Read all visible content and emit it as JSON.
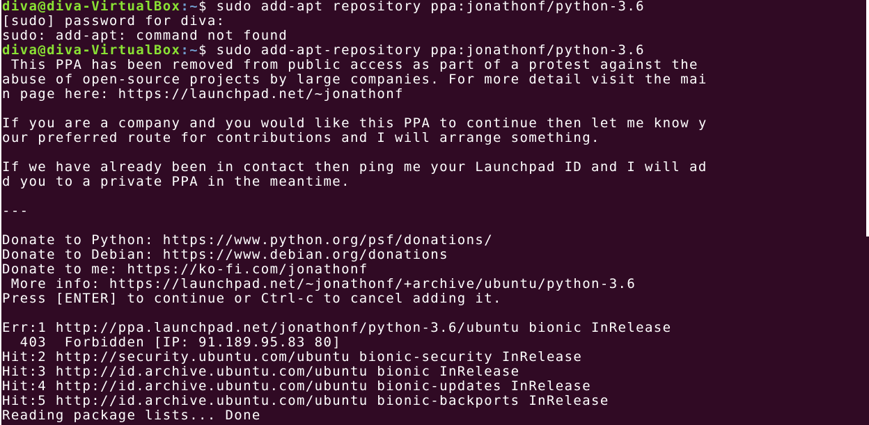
{
  "terminal": {
    "prompt_user": "diva@diva-VirtualBox",
    "prompt_path": ":~",
    "prompt_symbol": "$ ",
    "colors": {
      "background": "#300a24",
      "text": "#ffffff",
      "prompt_user": "#8ae234",
      "prompt_path": "#729fcf"
    },
    "lines": [
      {
        "type": "prompt",
        "command": "sudo add-apt repository ppa:jonathonf/python-3.6"
      },
      {
        "type": "output",
        "text": "[sudo] password for diva:"
      },
      {
        "type": "output",
        "text": "sudo: add-apt: command not found"
      },
      {
        "type": "prompt",
        "command": "sudo add-apt-repository ppa:jonathonf/python-3.6"
      },
      {
        "type": "output",
        "text": " This PPA has been removed from public access as part of a protest against the"
      },
      {
        "type": "output",
        "text": "abuse of open-source projects by large companies. For more detail visit the mai"
      },
      {
        "type": "output",
        "text": "n page here: https://launchpad.net/~jonathonf"
      },
      {
        "type": "output",
        "text": ""
      },
      {
        "type": "output",
        "text": "If you are a company and you would like this PPA to continue then let me know y"
      },
      {
        "type": "output",
        "text": "our preferred route for contributions and I will arrange something."
      },
      {
        "type": "output",
        "text": ""
      },
      {
        "type": "output",
        "text": "If we have already been in contact then ping me your Launchpad ID and I will ad"
      },
      {
        "type": "output",
        "text": "d you to a private PPA in the meantime."
      },
      {
        "type": "output",
        "text": ""
      },
      {
        "type": "output",
        "text": "---"
      },
      {
        "type": "output",
        "text": ""
      },
      {
        "type": "output",
        "text": "Donate to Python: https://www.python.org/psf/donations/"
      },
      {
        "type": "output",
        "text": "Donate to Debian: https://www.debian.org/donations"
      },
      {
        "type": "output",
        "text": "Donate to me: https://ko-fi.com/jonathonf"
      },
      {
        "type": "output",
        "text": " More info: https://launchpad.net/~jonathonf/+archive/ubuntu/python-3.6"
      },
      {
        "type": "output",
        "text": "Press [ENTER] to continue or Ctrl-c to cancel adding it."
      },
      {
        "type": "output",
        "text": ""
      },
      {
        "type": "output",
        "text": "Err:1 http://ppa.launchpad.net/jonathonf/python-3.6/ubuntu bionic InRelease"
      },
      {
        "type": "output",
        "text": "  403  Forbidden [IP: 91.189.95.83 80]"
      },
      {
        "type": "output",
        "text": "Hit:2 http://security.ubuntu.com/ubuntu bionic-security InRelease"
      },
      {
        "type": "output",
        "text": "Hit:3 http://id.archive.ubuntu.com/ubuntu bionic InRelease"
      },
      {
        "type": "output",
        "text": "Hit:4 http://id.archive.ubuntu.com/ubuntu bionic-updates InRelease"
      },
      {
        "type": "output",
        "text": "Hit:5 http://id.archive.ubuntu.com/ubuntu bionic-backports InRelease"
      },
      {
        "type": "output",
        "text": "Reading package lists... Done"
      }
    ]
  }
}
